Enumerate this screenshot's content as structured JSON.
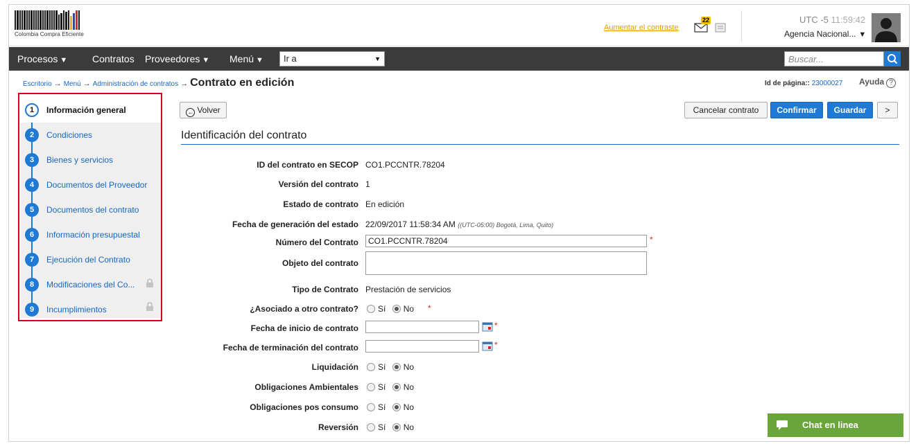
{
  "header": {
    "logo_text": "Colombia Compra Eficiente",
    "contrast_link": "Aumentar el contraste",
    "notifications_count": "22",
    "utc_prefix": "UTC -5",
    "time": "11:59:42",
    "agency": "Agencia Nacional..."
  },
  "nav": {
    "procesos": "Procesos",
    "contratos": "Contratos",
    "proveedores": "Proveedores",
    "menu": "Menú",
    "goto_value": "Ir a",
    "search_placeholder": "Buscar..."
  },
  "breadcrumb": {
    "escritorio": "Escritorio",
    "menu": "Menú",
    "admin": "Administración de contratos",
    "current": "Contrato en edición"
  },
  "page_id": {
    "label": "Id de página::",
    "value": "23000027"
  },
  "help_label": "Ayuda",
  "steps": [
    {
      "num": "1",
      "label": "Información general",
      "active": true
    },
    {
      "num": "2",
      "label": "Condiciones"
    },
    {
      "num": "3",
      "label": "Bienes y servicios"
    },
    {
      "num": "4",
      "label": "Documentos del Proveedor"
    },
    {
      "num": "5",
      "label": "Documentos del contrato"
    },
    {
      "num": "6",
      "label": "Información presupuestal"
    },
    {
      "num": "7",
      "label": "Ejecución del Contrato"
    },
    {
      "num": "8",
      "label": "Modificaciones del Co...",
      "locked": true
    },
    {
      "num": "9",
      "label": "Incumplimientos",
      "locked": true
    }
  ],
  "actions": {
    "back": "Volver",
    "cancel": "Cancelar contrato",
    "confirm": "Confirmar",
    "save": "Guardar",
    "next": ">"
  },
  "section_title": "Identificación del contrato",
  "form": {
    "secop_id_label": "ID del contrato en SECOP",
    "secop_id_value": "CO1.PCCNTR.78204",
    "version_label": "Versión del contrato",
    "version_value": "1",
    "status_label": "Estado de contrato",
    "status_value": "En edición",
    "status_date_label": "Fecha de generación del estado",
    "status_date_value": "22/09/2017 11:58:34 AM",
    "status_date_tz": "((UTC-05:00) Bogotá, Lima, Quito)",
    "contract_number_label": "Número del Contrato",
    "contract_number_value": "CO1.PCCNTR.78204",
    "object_label": "Objeto del contrato",
    "object_value": "",
    "type_label": "Tipo de Contrato",
    "type_value": "Prestación de servicios",
    "associated_label": "¿Asociado a otro contrato?",
    "start_date_label": "Fecha de inicio de contrato",
    "end_date_label": "Fecha de terminación del contrato",
    "liquidation_label": "Liquidación",
    "environmental_label": "Obligaciones Ambientales",
    "post_consumption_label": "Obligaciones pos consumo",
    "reversion_label": "Reversión",
    "yes": "Sí",
    "no": "No",
    "required_mark": "*"
  },
  "chat_label": "Chat en linea",
  "colors": {
    "primary": "#1e7ad4",
    "link": "#1767c3",
    "navbar": "#3b3b3b",
    "highlight_border": "#d8001f",
    "chat": "#6aa53a",
    "contrast_link": "#e69a00"
  }
}
